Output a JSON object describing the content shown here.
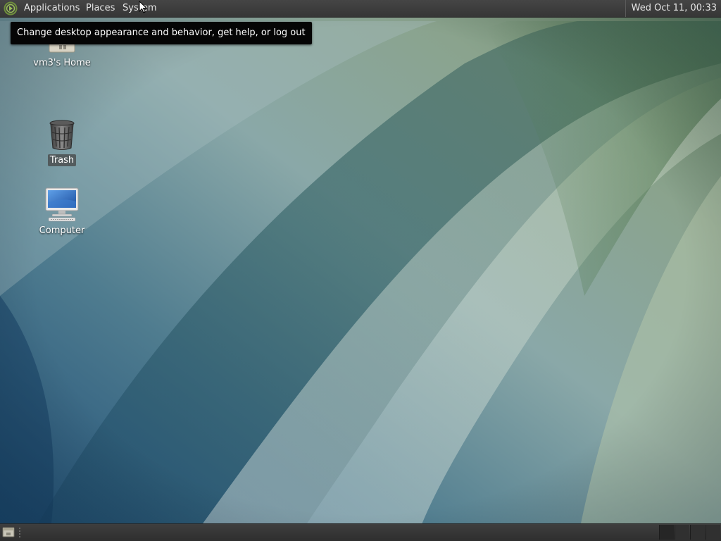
{
  "top_panel": {
    "menus": {
      "applications": "Applications",
      "places": "Places",
      "system": "System"
    },
    "clock": "Wed Oct 11, 00:33"
  },
  "tooltip": {
    "text": "Change desktop appearance and behavior, get help, or log out"
  },
  "desktop": {
    "icons": [
      {
        "name": "vm3's Home",
        "icon": "home-folder-icon"
      },
      {
        "name": "Trash",
        "icon": "trash-icon"
      },
      {
        "name": "Computer",
        "icon": "computer-icon"
      }
    ]
  },
  "bottom_panel": {
    "icons": [
      "show-desktop-icon",
      "workspace-switcher"
    ],
    "workspaces": 4,
    "active_workspace": 1
  },
  "colors": {
    "panel": "#3b3b3b",
    "wallpaper_blue": "#2c5f83",
    "wallpaper_green": "#5d7a5a",
    "tooltip_bg": "#050505"
  }
}
